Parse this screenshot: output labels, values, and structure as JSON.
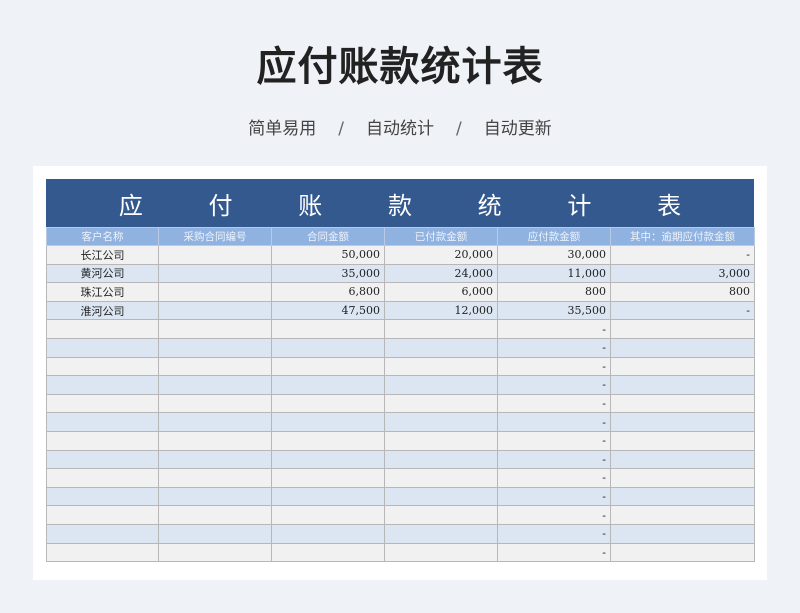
{
  "page": {
    "title": "应付账款统计表",
    "subtitle_items": [
      "简单易用",
      "自动统计",
      "自动更新"
    ],
    "separator": "/"
  },
  "sheet": {
    "banner_chars": [
      "应",
      "付",
      "账",
      "款",
      "统",
      "计",
      "表"
    ],
    "columns": [
      "客户名称",
      "采购合同编号",
      "合同金额",
      "已付款金额",
      "应付款金额",
      "其中：逾期应付款金额"
    ],
    "rows": [
      [
        "长江公司",
        "",
        "50,000",
        "20,000",
        "30,000",
        "-"
      ],
      [
        "黄河公司",
        "",
        "35,000",
        "24,000",
        "11,000",
        "3,000"
      ],
      [
        "珠江公司",
        "",
        "6,800",
        "6,000",
        "800",
        "800"
      ],
      [
        "淮河公司",
        "",
        "47,500",
        "12,000",
        "35,500",
        "-"
      ],
      [
        "",
        "",
        "",
        "",
        "-",
        ""
      ],
      [
        "",
        "",
        "",
        "",
        "-",
        ""
      ],
      [
        "",
        "",
        "",
        "",
        "-",
        ""
      ],
      [
        "",
        "",
        "",
        "",
        "-",
        ""
      ],
      [
        "",
        "",
        "",
        "",
        "-",
        ""
      ],
      [
        "",
        "",
        "",
        "",
        "-",
        ""
      ],
      [
        "",
        "",
        "",
        "",
        "-",
        ""
      ],
      [
        "",
        "",
        "",
        "",
        "-",
        ""
      ],
      [
        "",
        "",
        "",
        "",
        "-",
        ""
      ],
      [
        "",
        "",
        "",
        "",
        "-",
        ""
      ],
      [
        "",
        "",
        "",
        "",
        "-",
        ""
      ],
      [
        "",
        "",
        "",
        "",
        "-",
        ""
      ],
      [
        "",
        "",
        "",
        "",
        "-",
        ""
      ]
    ]
  }
}
